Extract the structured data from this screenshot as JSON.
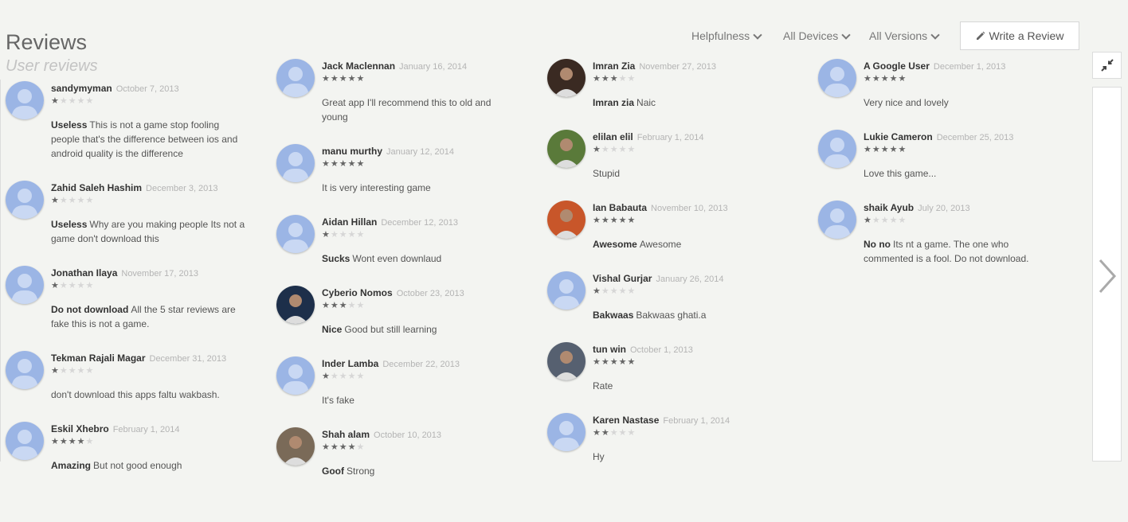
{
  "header": {
    "title": "Reviews",
    "subtitle": "User reviews",
    "filters": [
      "Helpfulness",
      "All Devices",
      "All Versions"
    ],
    "write_review": "Write a Review"
  },
  "colors": {
    "background": "#f3f4f1",
    "star_on": "#666666",
    "star_off": "#d6d6d6",
    "avatar_default": "#9bb5e5"
  },
  "reviews": [
    {
      "author": "sandymyman",
      "date": "October 7, 2013",
      "rating": 1,
      "headline": "Useless",
      "text": "This is not a game stop fooling people that's the difference between ios and android quality is the difference",
      "avatar": "default-avatar"
    },
    {
      "author": "Zahid Saleh Hashim",
      "date": "December 3, 2013",
      "rating": 1,
      "headline": "Useless",
      "text": "Why are you making people Its not a game don't download this",
      "avatar": "default-avatar"
    },
    {
      "author": "Jonathan Ilaya",
      "date": "November 17, 2013",
      "rating": 1,
      "headline": "Do not download",
      "text": "All the 5 star reviews are fake this is not a game.",
      "avatar": "default-avatar"
    },
    {
      "author": "Tekman Rajali Magar",
      "date": "December 31, 2013",
      "rating": 1,
      "headline": "",
      "text": "don't download this apps faltu wakbash.",
      "avatar": "default-avatar"
    },
    {
      "author": "Eskil Xhebro",
      "date": "February 1, 2014",
      "rating": 4,
      "headline": "Amazing",
      "text": "But not good enough",
      "avatar": "default-avatar"
    },
    {
      "author": "Jack Maclennan",
      "date": "January 16, 2014",
      "rating": 5,
      "headline": "",
      "text": "Great app I'll recommend this to old and young",
      "avatar": "default-avatar"
    },
    {
      "author": "manu murthy",
      "date": "January 12, 2014",
      "rating": 5,
      "headline": "",
      "text": "It is very interesting game",
      "avatar": "default-avatar"
    },
    {
      "author": "Aidan Hillan",
      "date": "December 12, 2013",
      "rating": 1,
      "headline": "Sucks",
      "text": "Wont even downlaud",
      "avatar": "default-avatar"
    },
    {
      "author": "Cyberio Nomos",
      "date": "October 23, 2013",
      "rating": 3,
      "headline": "Nice",
      "text": "Good but still learning",
      "avatar": "photo-avatar"
    },
    {
      "author": "Inder Lamba",
      "date": "December 22, 2013",
      "rating": 1,
      "headline": "",
      "text": "It's fake",
      "avatar": "default-avatar"
    },
    {
      "author": "Shah alam",
      "date": "October 10, 2013",
      "rating": 4,
      "headline": "Goof",
      "text": "Strong",
      "avatar": "photo-avatar"
    },
    {
      "author": "Imran Zia",
      "date": "November 27, 2013",
      "rating": 3,
      "headline": "Imran zia",
      "text": "Naic",
      "avatar": "photo-avatar"
    },
    {
      "author": "elilan elil",
      "date": "February 1, 2014",
      "rating": 1,
      "headline": "",
      "text": "Stupid",
      "avatar": "photo-avatar"
    },
    {
      "author": "Ian Babauta",
      "date": "November 10, 2013",
      "rating": 5,
      "headline": "Awesome",
      "text": "Awesome",
      "avatar": "photo-avatar"
    },
    {
      "author": "Vishal Gurjar",
      "date": "January 26, 2014",
      "rating": 1,
      "headline": "Bakwaas",
      "text": "Bakwaas ghati.a",
      "avatar": "default-avatar"
    },
    {
      "author": "tun win",
      "date": "October 1, 2013",
      "rating": 5,
      "headline": "",
      "text": "Rate",
      "avatar": "photo-avatar"
    },
    {
      "author": "Karen Nastase",
      "date": "February 1, 2014",
      "rating": 2,
      "headline": "",
      "text": "Hy",
      "avatar": "default-avatar"
    },
    {
      "author": "A Google User",
      "date": "December 1, 2013",
      "rating": 5,
      "headline": "",
      "text": "Very nice and lovely",
      "avatar": "default-avatar"
    },
    {
      "author": "Lukie Cameron",
      "date": "December 25, 2013",
      "rating": 5,
      "headline": "",
      "text": "Love this game...",
      "avatar": "default-avatar"
    },
    {
      "author": "shaik Ayub",
      "date": "July 20, 2013",
      "rating": 1,
      "headline": "No no",
      "text": "Its nt a game. The one who commented is a fool. Do not download.",
      "avatar": "default-avatar"
    }
  ]
}
